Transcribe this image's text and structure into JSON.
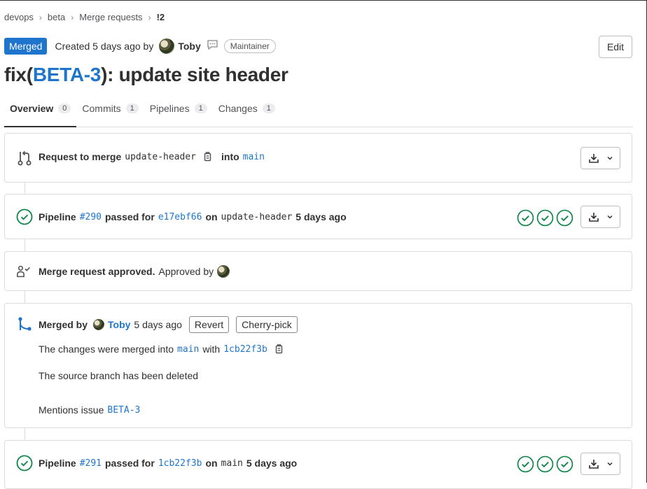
{
  "breadcrumb": [
    "devops",
    "beta",
    "Merge requests",
    "!2"
  ],
  "header": {
    "status_badge": "Merged",
    "created_text": "Created 5 days ago by",
    "author": "Toby",
    "role": "Maintainer",
    "edit_label": "Edit"
  },
  "title": {
    "prefix": "fix(",
    "issue_link": "BETA-3",
    "suffix": "): update site header"
  },
  "tabs": [
    {
      "label": "Overview",
      "count": "0"
    },
    {
      "label": "Commits",
      "count": "1"
    },
    {
      "label": "Pipelines",
      "count": "1"
    },
    {
      "label": "Changes",
      "count": "1"
    }
  ],
  "merge_request": {
    "request_text": "Request to merge",
    "source_branch": "update-header",
    "into_text": "into",
    "target_branch": "main"
  },
  "pipeline1": {
    "label": "Pipeline",
    "id": "#290",
    "passed_for": "passed for",
    "commit": "e17ebf66",
    "on": "on",
    "branch": "update-header",
    "time": "5 days ago"
  },
  "approval": {
    "title": "Merge request approved.",
    "approved_by": "Approved by"
  },
  "merged": {
    "merged_by": "Merged by",
    "author": "Toby",
    "time": "5 days ago",
    "revert_label": "Revert",
    "cherry_pick_label": "Cherry-pick",
    "merged_into_text": "The changes were merged into",
    "target_branch": "main",
    "with_text": "with",
    "commit": "1cb22f3b",
    "deleted_text": "The source branch has been deleted",
    "mentions_text": "Mentions issue",
    "mentions_issue": "BETA-3"
  },
  "pipeline2": {
    "label": "Pipeline",
    "id": "#291",
    "passed_for": "passed for",
    "commit": "1cb22f3b",
    "on": "on",
    "branch": "main",
    "time": "5 days ago"
  },
  "colors": {
    "link": "#1f75cb",
    "success": "#108548",
    "badge": "#1f75cb"
  }
}
